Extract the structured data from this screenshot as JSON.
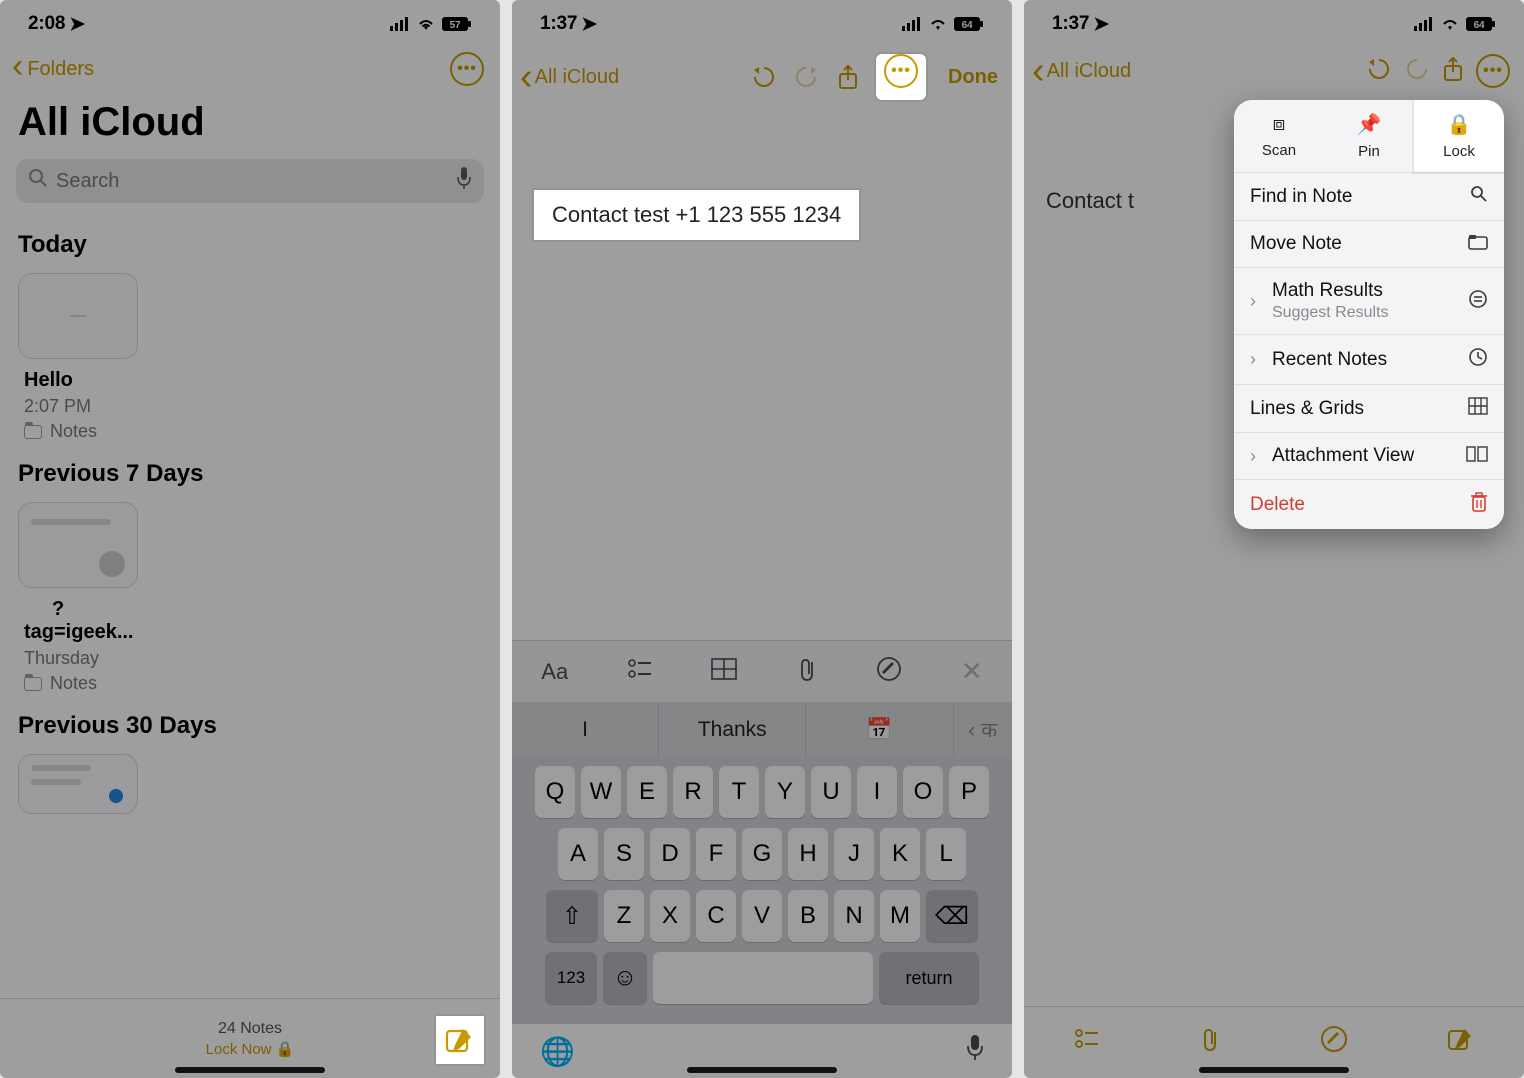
{
  "screen1": {
    "statusbar": {
      "time": "2:08",
      "battery_text": "57"
    },
    "nav": {
      "back_label": "Folders"
    },
    "title": "All iCloud",
    "search": {
      "placeholder": "Search"
    },
    "sections": {
      "today": {
        "heading": "Today",
        "note": {
          "name": "Hello",
          "time": "2:07 PM",
          "location": "Notes"
        }
      },
      "prev7": {
        "heading": "Previous 7 Days",
        "note": {
          "name": "?",
          "subtitle": "tag=igeek...",
          "time": "Thursday",
          "location": "Notes"
        }
      },
      "prev30": {
        "heading": "Previous 30 Days"
      }
    },
    "footer": {
      "count": "24 Notes",
      "locknow": "Lock Now 🔒"
    }
  },
  "screen2": {
    "statusbar": {
      "time": "1:37",
      "battery_text": "64"
    },
    "nav": {
      "back_label": "All iCloud",
      "done_label": "Done"
    },
    "note_text": "Contact test +1 123 555 1234",
    "suggestions": {
      "s1": "I",
      "s2": "Thanks",
      "s3": "📅"
    },
    "keyboard": {
      "row1": [
        "Q",
        "W",
        "E",
        "R",
        "T",
        "Y",
        "U",
        "I",
        "O",
        "P"
      ],
      "row2": [
        "A",
        "S",
        "D",
        "F",
        "G",
        "H",
        "J",
        "K",
        "L"
      ],
      "row3": [
        "Z",
        "X",
        "C",
        "V",
        "B",
        "N",
        "M"
      ],
      "numkey": "123",
      "returnkey": "return"
    }
  },
  "screen3": {
    "statusbar": {
      "time": "1:37",
      "battery_text": "64"
    },
    "nav": {
      "back_label": "All iCloud"
    },
    "note_text_truncated": "Contact t",
    "sheet": {
      "scan": "Scan",
      "pin": "Pin",
      "lock": "Lock",
      "find": "Find in Note",
      "move": "Move Note",
      "math": "Math Results",
      "math_sub": "Suggest Results",
      "recent": "Recent Notes",
      "lines": "Lines & Grids",
      "attach": "Attachment View",
      "delete": "Delete"
    }
  }
}
